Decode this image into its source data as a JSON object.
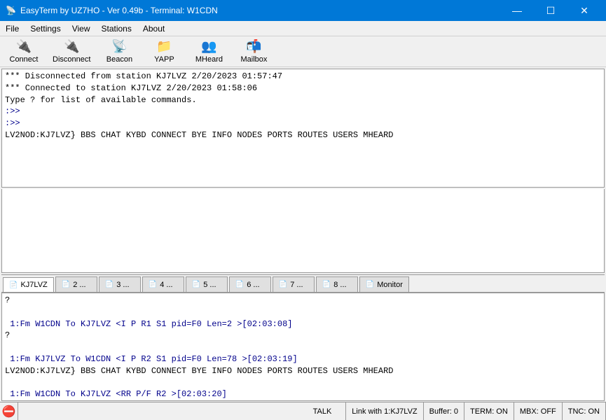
{
  "titlebar": {
    "title": "EasyTerm by UZ7HO - Ver 0.49b - Terminal: W1CDN",
    "icon": "📡",
    "minimize": "—",
    "maximize": "☐",
    "close": "✕"
  },
  "menubar": {
    "items": [
      "File",
      "Settings",
      "View",
      "Stations",
      "About"
    ]
  },
  "toolbar": {
    "buttons": [
      {
        "id": "connect",
        "label": "Connect",
        "icon": "🔌",
        "color": "gray"
      },
      {
        "id": "disconnect",
        "label": "Disconnect",
        "icon": "🔌",
        "color": "red"
      },
      {
        "id": "beacon",
        "label": "Beacon",
        "icon": "📡",
        "color": "blue"
      },
      {
        "id": "yapp",
        "label": "YAPP",
        "icon": "📁",
        "color": "green"
      },
      {
        "id": "mheard",
        "label": "MHeard",
        "icon": "👥",
        "color": "orange"
      },
      {
        "id": "mailbox",
        "label": "Mailbox",
        "icon": "📬",
        "color": "brown"
      }
    ]
  },
  "terminal": {
    "lines": [
      {
        "text": "*** Disconnected from station KJ7LVZ 2/20/2023 01:57:47",
        "style": "system"
      },
      {
        "text": "*** Connected to station KJ7LVZ 2/20/2023 01:58:06",
        "style": "system"
      },
      {
        "text": "Type ? for list of available commands.",
        "style": "system"
      },
      {
        "text": ":>>",
        "style": "command"
      },
      {
        "text": ":>>",
        "style": "command"
      },
      {
        "text": "LV2NOD:KJ7LVZ} BBS CHAT KYBD CONNECT BYE INFO NODES PORTS ROUTES USERS MHEARD",
        "style": "response"
      }
    ]
  },
  "tabs": [
    {
      "label": "KJ7LVZ",
      "icon": "📄",
      "active": true
    },
    {
      "label": "2 ...",
      "icon": "📄",
      "active": false
    },
    {
      "label": "3 ...",
      "icon": "📄",
      "active": false
    },
    {
      "label": "4 ...",
      "icon": "📄",
      "active": false
    },
    {
      "label": "5 ...",
      "icon": "📄",
      "active": false
    },
    {
      "label": "6 ...",
      "icon": "📄",
      "active": false
    },
    {
      "label": "7 ...",
      "icon": "📄",
      "active": false
    },
    {
      "label": "8 ...",
      "icon": "📄",
      "active": false
    },
    {
      "label": "Monitor",
      "icon": "📄",
      "active": false
    }
  ],
  "monitor": {
    "lines": [
      {
        "text": "?",
        "style": "black"
      },
      {
        "text": "",
        "style": "black"
      },
      {
        "text": " 1:Fm W1CDN To KJ7LVZ <I P R1 S1 pid=F0 Len=2 >[02:03:08]",
        "style": "blue"
      },
      {
        "text": "?",
        "style": "black"
      },
      {
        "text": "",
        "style": "black"
      },
      {
        "text": " 1:Fm KJ7LVZ To W1CDN <I P R2 S1 pid=F0 Len=78 >[02:03:19]",
        "style": "blue"
      },
      {
        "text": "LV2NOD:KJ7LVZ} BBS CHAT KYBD CONNECT BYE INFO NODES PORTS ROUTES USERS MHEARD",
        "style": "black"
      },
      {
        "text": "",
        "style": "black"
      },
      {
        "text": " 1:Fm W1CDN To KJ7LVZ <RR P/F R2 >[02:03:20]",
        "style": "blue"
      }
    ]
  },
  "statusbar": {
    "stop_icon": "⛔",
    "talk_label": "TALK",
    "link": "Link with 1:KJ7LVZ",
    "buffer": "Buffer: 0",
    "term": "TERM: ON",
    "mbx": "MBX: OFF",
    "tnc": "TNC: ON"
  }
}
